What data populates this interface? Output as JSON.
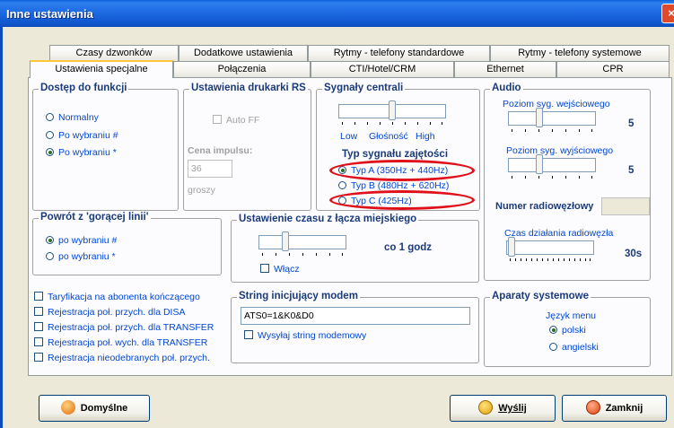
{
  "window": {
    "title": "Inne ustawienia",
    "close_glyph": "×"
  },
  "tabs": {
    "row1": [
      "Czasy dzwonków",
      "Dodatkowe ustawienia",
      "Rytmy - telefony standardowe",
      "Rytmy - telefony systemowe"
    ],
    "row2": [
      "Ustawienia specjalne",
      "Połączenia",
      "CTI/Hotel/CRM",
      "Ethernet",
      "CPR"
    ],
    "active": "Ustawienia specjalne"
  },
  "dostep": {
    "title": "Dostęp do funkcji",
    "options": [
      "Normalny",
      "Po wybraniu #",
      "Po wybraniu *"
    ],
    "selected": 2
  },
  "drukarka": {
    "title": "Ustawienia drukarki RS",
    "autoff_label": "Auto FF",
    "cena_label": "Cena impulsu:",
    "cena_value": "36",
    "groszy": "groszy"
  },
  "sygnaly": {
    "title": "Sygnały centrali",
    "slider_labels": [
      "Low",
      "Głośność",
      "High"
    ],
    "slider_value": 0.5,
    "typ_title": "Typ sygnału zajętości",
    "typ_options": [
      "Typ A (350Hz + 440Hz)",
      "Typ B (480Hz + 620Hz)",
      "Typ C (425Hz)"
    ],
    "typ_selected": 0
  },
  "audio": {
    "title": "Audio",
    "wej_label": "Poziom syg. wejściowego",
    "wej_value": "5",
    "wyj_label": "Poziom syg. wyjściowego",
    "wyj_value": "5",
    "numer_label": "Numer radiowęzłowy",
    "numer_value": "",
    "czas_label": "Czas działania radiowęzła",
    "czas_value": "30s"
  },
  "powrot": {
    "title": "Powrót z 'gorącej linii'",
    "options": [
      "po wybraniu #",
      "po wybraniu *"
    ],
    "selected": 0
  },
  "czas_lacza": {
    "title": "Ustawienie czasu z łącza miejskiego",
    "value": "co 1 godz",
    "wlacz_label": "Włącz"
  },
  "checkboxes": [
    "Taryfikacja na abonenta kończącego",
    "Rejestracja poł. przych. dla DISA",
    "Rejestracja poł. przych. dla TRANSFER",
    "Rejestracja poł. wych. dla TRANSFER",
    "Rejestracja nieodebranych poł. przych."
  ],
  "modem": {
    "title": "String inicjujący modem",
    "value": "ATS0=1&K0&D0",
    "send_label": "Wysyłaj string modemowy"
  },
  "aparaty": {
    "title": "Aparaty systemowe",
    "jezyk_label": "Język menu",
    "options": [
      "polski",
      "angielski"
    ],
    "selected": 0
  },
  "buttons": {
    "domyslne": "Domyślne",
    "wyslij": "Wyślij",
    "zamknij": "Zamknij"
  },
  "colors": {
    "accent": "#0046d5",
    "titlebar": "#0c4bb8",
    "highlight": "#e0101a"
  }
}
